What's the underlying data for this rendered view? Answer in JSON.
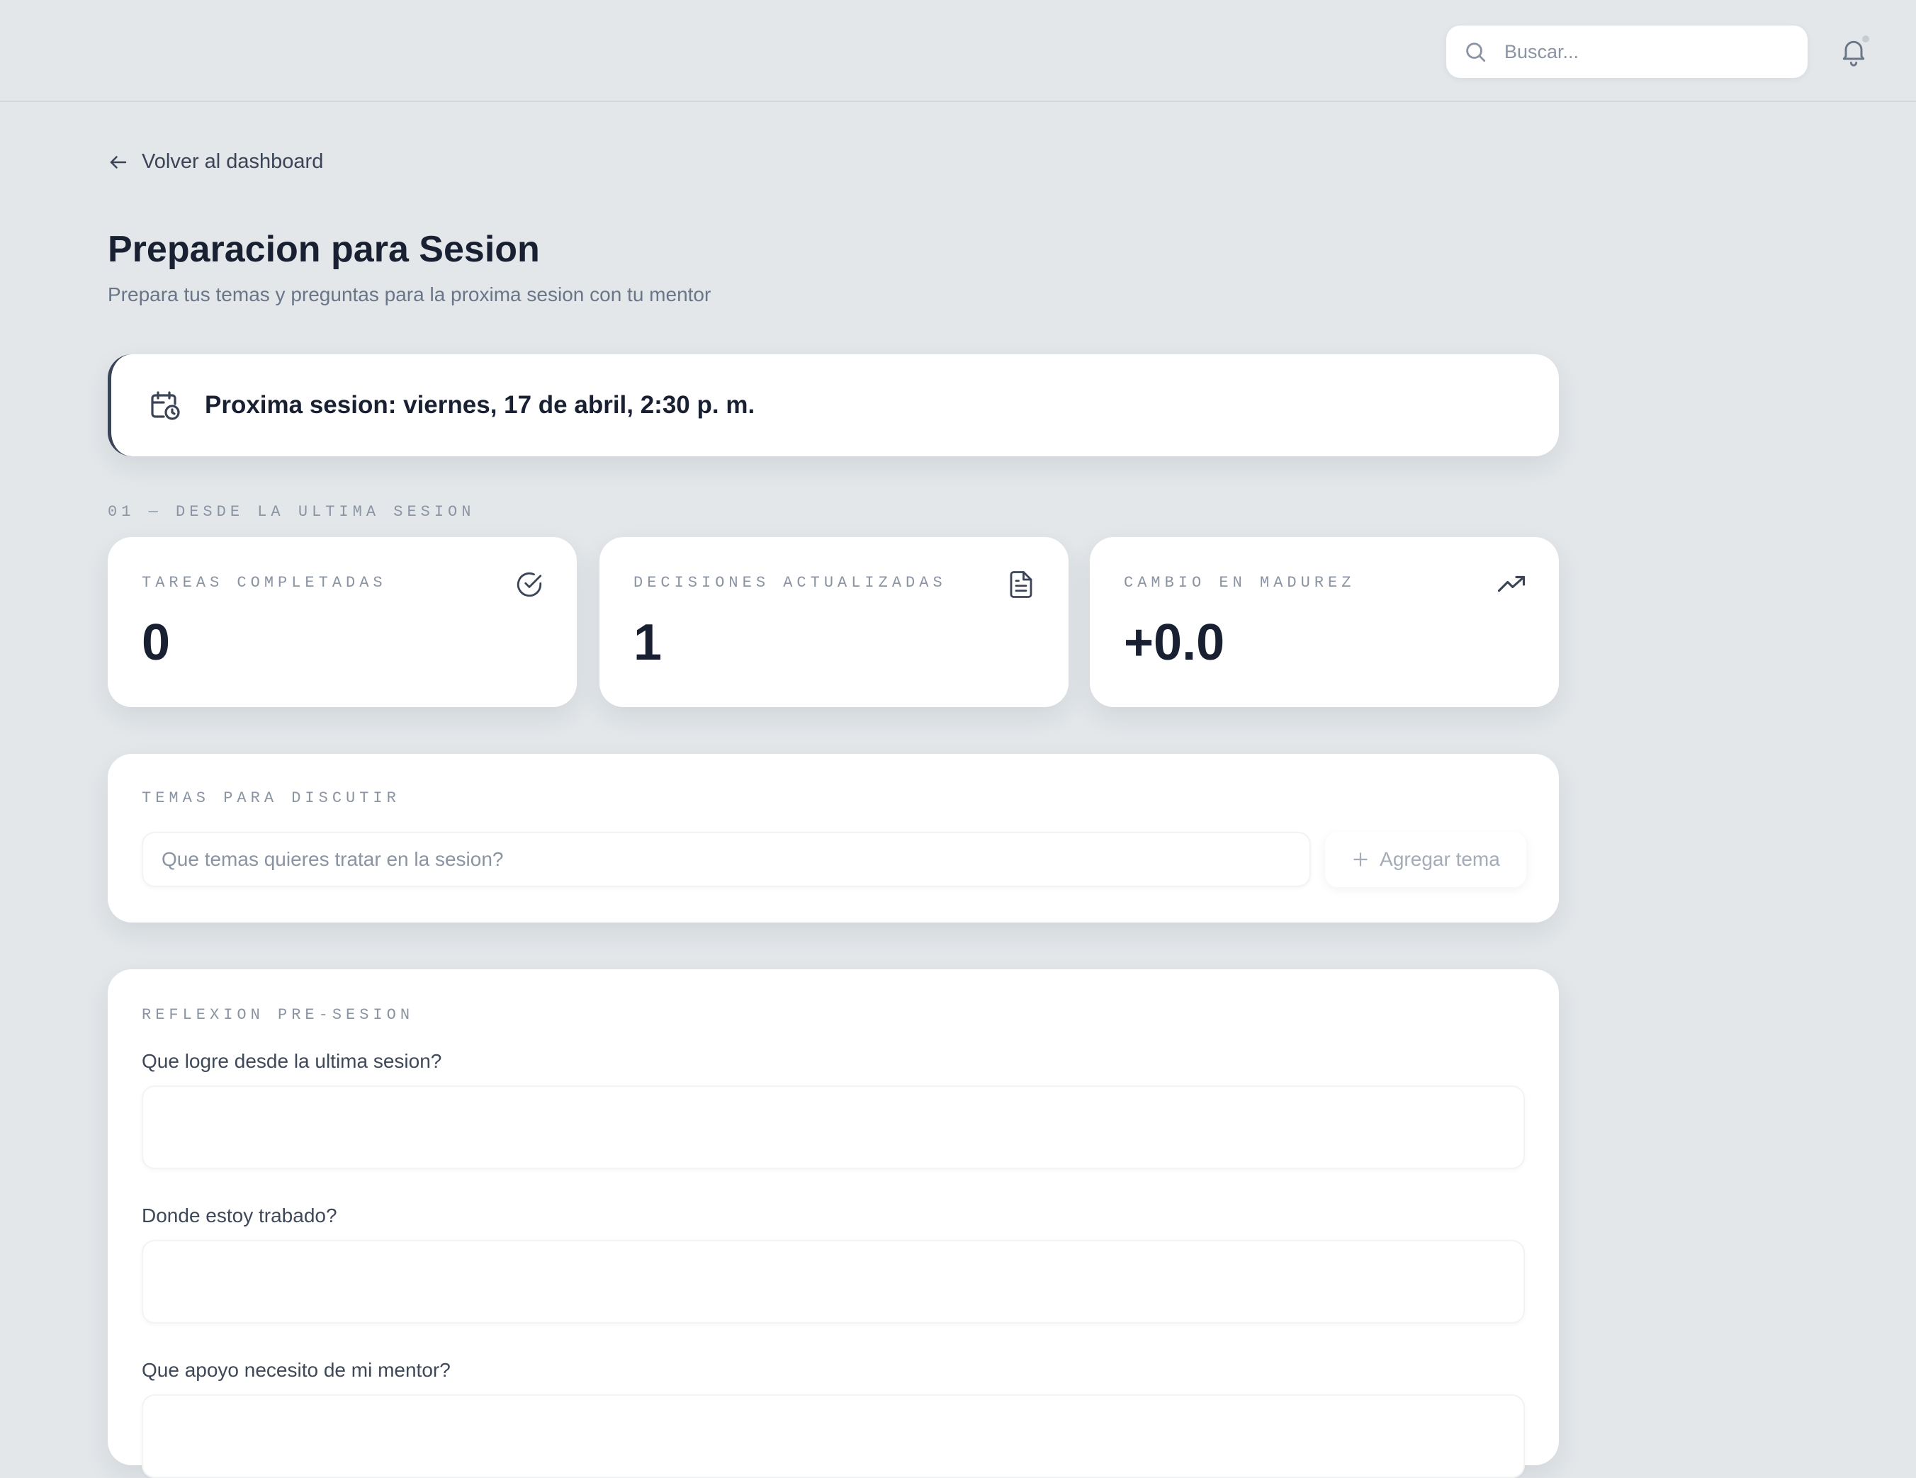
{
  "header": {
    "search": {
      "placeholder": "Buscar...",
      "value": ""
    },
    "icons": {
      "search": "search-icon",
      "notifications": "bell-icon"
    }
  },
  "nav": {
    "back_label": "Volver al dashboard"
  },
  "page": {
    "title": "Preparacion para Sesion",
    "subtitle": "Prepara tus temas y preguntas para la proxima sesion con tu mentor"
  },
  "next_session": {
    "icon": "calendar-clock-icon",
    "label": "Proxima sesion: viernes, 17 de abril, 2:30 p. m."
  },
  "since_last": {
    "section_label": "01 — DESDE LA ULTIMA SESION",
    "stats": [
      {
        "label": "TAREAS COMPLETADAS",
        "value": "0",
        "icon": "check-circle-icon"
      },
      {
        "label": "DECISIONES ACTUALIZADAS",
        "value": "1",
        "icon": "document-icon"
      },
      {
        "label": "CAMBIO EN MADUREZ",
        "value": "+0.0",
        "icon": "trending-up-icon"
      }
    ]
  },
  "topics": {
    "section_label": "TEMAS PARA DISCUTIR",
    "input_placeholder": "Que temas quieres tratar en la sesion?",
    "input_value": "",
    "add_label": "Agregar tema"
  },
  "reflection": {
    "section_label": "REFLEXION PRE-SESION",
    "questions": [
      {
        "label": "Que logre desde la ultima sesion?",
        "value": ""
      },
      {
        "label": "Donde estoy trabado?",
        "value": ""
      },
      {
        "label": "Que apoyo necesito de mi mentor?",
        "value": ""
      }
    ]
  },
  "colors": {
    "background": "#e3e7ea",
    "card": "#ffffff",
    "text_primary": "#182032",
    "text_muted": "#8a94a3",
    "accent_border": "#3a4456"
  }
}
